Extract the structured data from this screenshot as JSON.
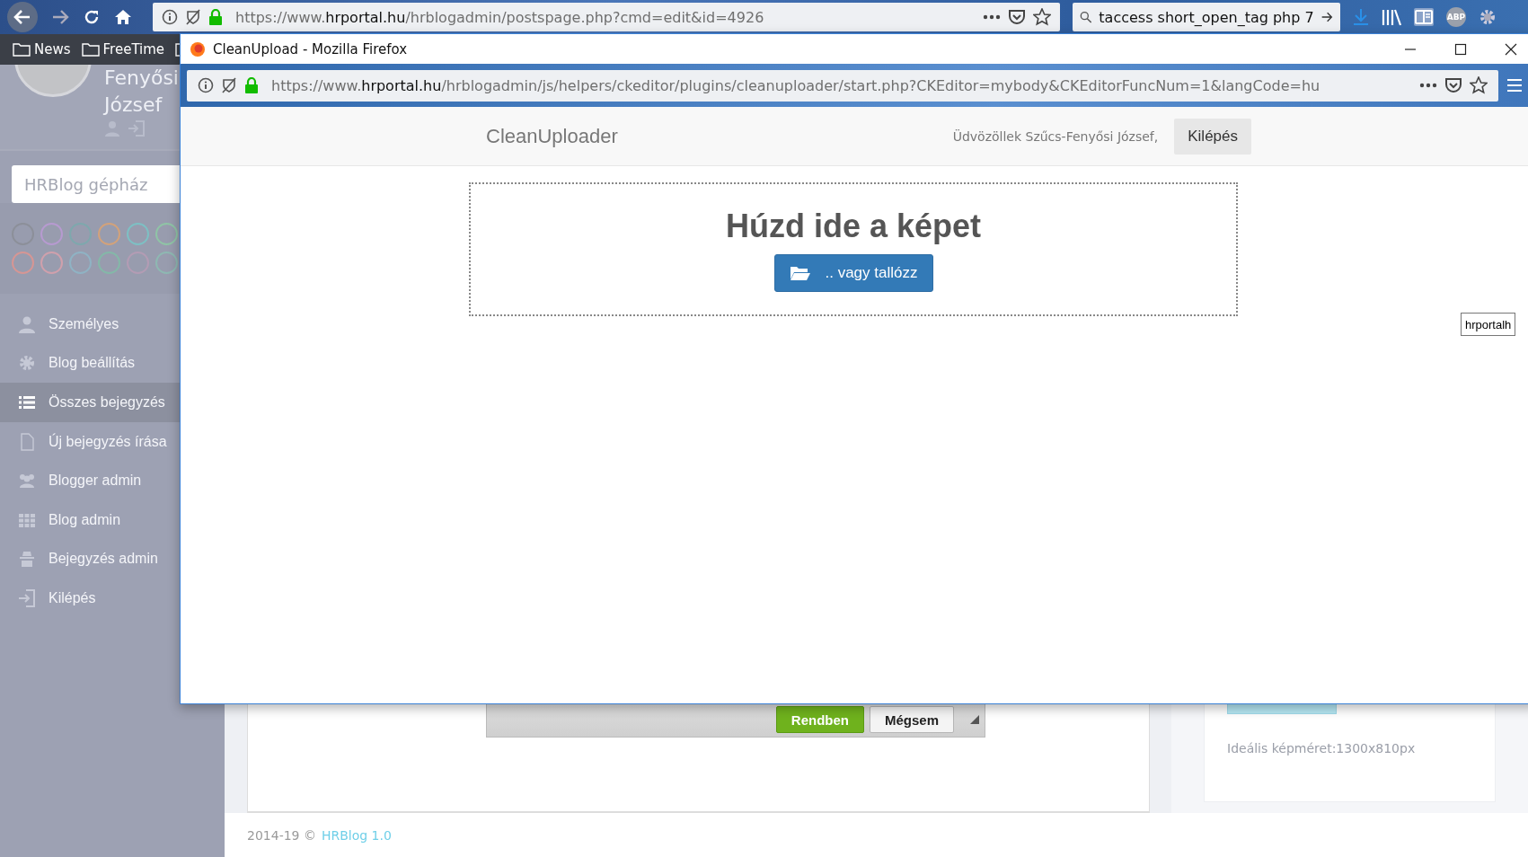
{
  "browser": {
    "url": "https://www.**hrportal.hu**/hrblogadmin/postspage.php?cmd=edit&id=4926",
    "search": "taccess short_open_tag php 7",
    "adblock_badge": "ABP"
  },
  "bookmarks": [
    {
      "label": "News"
    },
    {
      "label": "FreeTime"
    }
  ],
  "sidebar": {
    "name_lines": [
      "Fenyősi",
      "József"
    ],
    "search": {
      "placeholder": "HRBlog gépház"
    },
    "colors": [
      {
        "color": "#8c8f99"
      },
      {
        "color": "#b79ad0"
      },
      {
        "color": "#7ea8ad"
      },
      {
        "color": "#d3a27a"
      },
      {
        "color": "#7dc0c4"
      },
      {
        "color": "#8fc4a6"
      },
      {
        "color": "#d69694"
      },
      {
        "color": "#d0a0ac"
      },
      {
        "color": "#8fb3c4"
      },
      {
        "color": "#84b8a8"
      },
      {
        "color": "#b39cb4"
      },
      {
        "color": "#8eb8b2"
      }
    ],
    "items": [
      {
        "label": "Személyes",
        "selected": false
      },
      {
        "label": "Blog beállítás",
        "selected": false
      },
      {
        "label": "Összes bejegyzés",
        "selected": true
      },
      {
        "label": "Új bejegyzés írása",
        "selected": false
      },
      {
        "label": "Blogger admin",
        "selected": false
      },
      {
        "label": "Blog admin",
        "selected": false
      },
      {
        "label": "Bejegyzés admin",
        "selected": false
      },
      {
        "label": "Kilépés",
        "selected": false
      }
    ]
  },
  "page": {
    "dialog_buttons": [
      {
        "label": "Rendben",
        "kind": "primary"
      },
      {
        "label": "Mégsem",
        "kind": "default"
      }
    ],
    "ideal_size": "Ideális képméret:1300x810px",
    "footer": {
      "copyright": "2014-19 ©",
      "link": "HRBlog 1.0"
    },
    "tooltip": "hrportalh"
  },
  "popup": {
    "title": "CleanUpload - Mozilla Firefox",
    "url": "https://www.**hrportal.hu**/hrblogadmin/js/helpers/ckeditor/plugins/cleanuploader/start.php?CKEditor=mybody&CKEditorFuncNum=1&langCode=hu",
    "app": {
      "brand": "CleanUploader",
      "welcome": "Üdvözöllek Szűcs-Fenyősi József,",
      "logout": "Kilépés",
      "drop_title": "Húzd ide a képet",
      "browse": ".. vagy tallózz"
    }
  }
}
